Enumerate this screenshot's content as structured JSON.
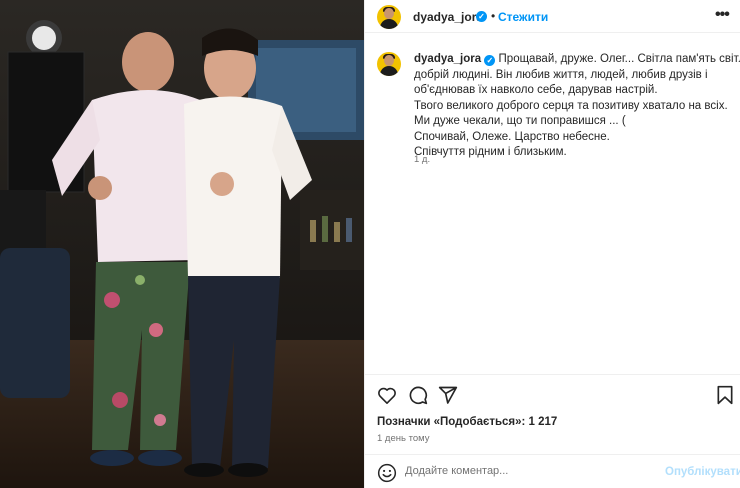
{
  "post": {
    "username": "dyadya_jora",
    "verified_mark": "✓",
    "follow_label": "Стежити",
    "separator": "•",
    "more_label": "•••",
    "caption_lines": [
      "Прощавай, друже. Олег... Світла пам'ять світлій",
      "добрій людині. Він любив життя, людей, любив друзів і",
      "об'єднював їх навколо себе, дарував настрій.",
      "Твого великого доброго серця та позитиву хватало на всіх.",
      "Ми дуже чекали, що ти поправишся ... (",
      "Спочивай, Олеже. Царство небесне.",
      "Співчуття рідним і близьким."
    ],
    "caption_time": "1 д.",
    "likes_text": "Позначки «Подобається»: 1 217",
    "time_ago": "1 день тому",
    "comment_placeholder": "Додайте коментар...",
    "publish_label": "Опублікувати"
  },
  "icons": {
    "like": "heart-icon",
    "comment": "comment-icon",
    "share": "share-icon",
    "save": "bookmark-icon",
    "emoji": "emoji-icon",
    "more": "more-options-icon"
  },
  "colors": {
    "accent": "#0095f6",
    "publish_disabled": "#b2dffc",
    "muted": "#737373",
    "avatar_bg": "#f2c200"
  }
}
